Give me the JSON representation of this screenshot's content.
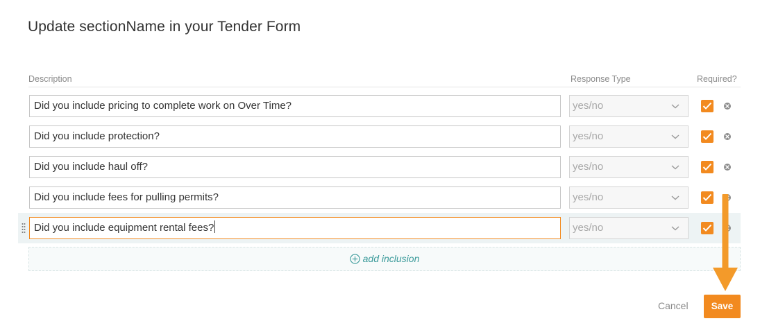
{
  "dialog": {
    "title": "Update sectionName in your Tender Form"
  },
  "table": {
    "headers": {
      "description": "Description",
      "response_type": "Response Type",
      "required": "Required?"
    },
    "rows": [
      {
        "description": "Did you include pricing to complete work on Over Time?",
        "response_type": "yes/no",
        "required": true
      },
      {
        "description": "Did you include protection?",
        "response_type": "yes/no",
        "required": true
      },
      {
        "description": "Did you include haul off?",
        "response_type": "yes/no",
        "required": true
      },
      {
        "description": "Did you include fees for pulling permits?",
        "response_type": "yes/no",
        "required": true
      },
      {
        "description": "Did you include equipment rental fees?",
        "response_type": "yes/no",
        "required": true
      }
    ]
  },
  "add_inclusion_label": "add inclusion",
  "actions": {
    "cancel_label": "Cancel",
    "save_label": "Save"
  },
  "colors": {
    "accent": "#f28a1f",
    "teal": "#3a9a9a",
    "active_row": "#edf3f4"
  }
}
